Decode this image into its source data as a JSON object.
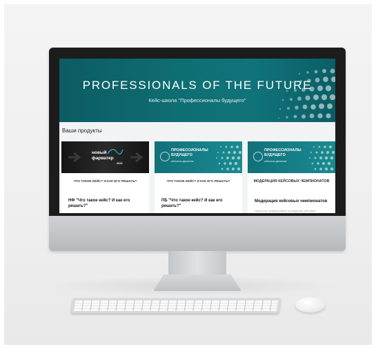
{
  "hero": {
    "title": "PROFESSIONALS OF THE FUTURE",
    "subtitle": "Кейс-школа \"Профессионалы будущего\""
  },
  "products": {
    "section_title": "Ваши продукты",
    "cards": [
      {
        "image_line1": "новый",
        "image_line2": "фарватер",
        "image_year": "2021",
        "caption": "ЧТО ТАКОЕ КЕЙС? И КАК ЕГО РЕШАТЬ?",
        "title": "НФ \"Что такое кейс? И как его решать?\""
      },
      {
        "image_line1": "ПРОФЕССИОНАЛЫ",
        "image_line2": "БУДУЩЕГО",
        "image_small": "кейсовые движения",
        "caption": "ЧТО ТАКОЕ КЕЙС? И КАК ЕГО РЕШАТЬ?",
        "title": "ПБ \"Что такое кейс? И как его решать?\""
      },
      {
        "image_line1": "ПРОФЕССИОНАЛЫ",
        "image_line2": "БУДУЩЕГО",
        "image_small": "кейсовые движения",
        "caption": "МОДЕРАЦИЯ КЕЙСОВЫХ ЧЕМПИОНАТОВ",
        "title": "Модерация кейсовых чемпионатов",
        "description": "Научитесь модерировать проведение кейсовых"
      }
    ]
  },
  "colors": {
    "hero_teal": "#0e6f73",
    "card_dark": "#1e1e1e",
    "accent_blue": "#2aa8c9"
  }
}
